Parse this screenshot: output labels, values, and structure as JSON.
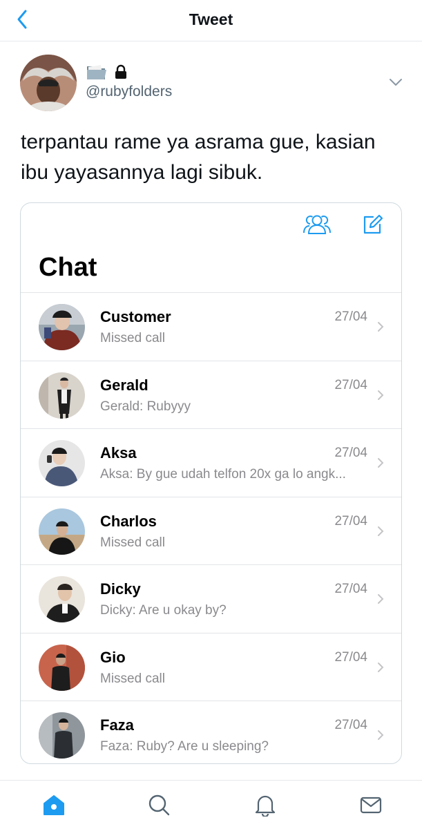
{
  "header": {
    "title": "Tweet"
  },
  "tweet": {
    "handle": "@rubyfolders",
    "name_icons": [
      "folder-icon",
      "lock-icon"
    ],
    "text": "terpantau rame ya asrama gue, kasian ibu yayasannya lagi sibuk."
  },
  "chat": {
    "title": "Chat",
    "items": [
      {
        "name": "Customer",
        "date": "27/04",
        "message": "Missed call"
      },
      {
        "name": "Gerald",
        "date": "27/04",
        "message": "Gerald: Rubyyy"
      },
      {
        "name": "Aksa",
        "date": "27/04",
        "message": "Aksa: By gue udah telfon 20x ga lo angk..."
      },
      {
        "name": "Charlos",
        "date": "27/04",
        "message": "Missed call"
      },
      {
        "name": "Dicky",
        "date": "27/04",
        "message": "Dicky: Are u okay by?"
      },
      {
        "name": "Gio",
        "date": "27/04",
        "message": "Missed call"
      },
      {
        "name": "Faza",
        "date": "27/04",
        "message": "Faza: Ruby? Are u sleeping?"
      }
    ]
  },
  "tabbar": [
    "home-icon",
    "search-icon",
    "bell-icon",
    "mail-icon"
  ],
  "colors": {
    "accent": "#1d9bf0",
    "secondary_text": "#536471",
    "divider": "#e1e4e8"
  }
}
